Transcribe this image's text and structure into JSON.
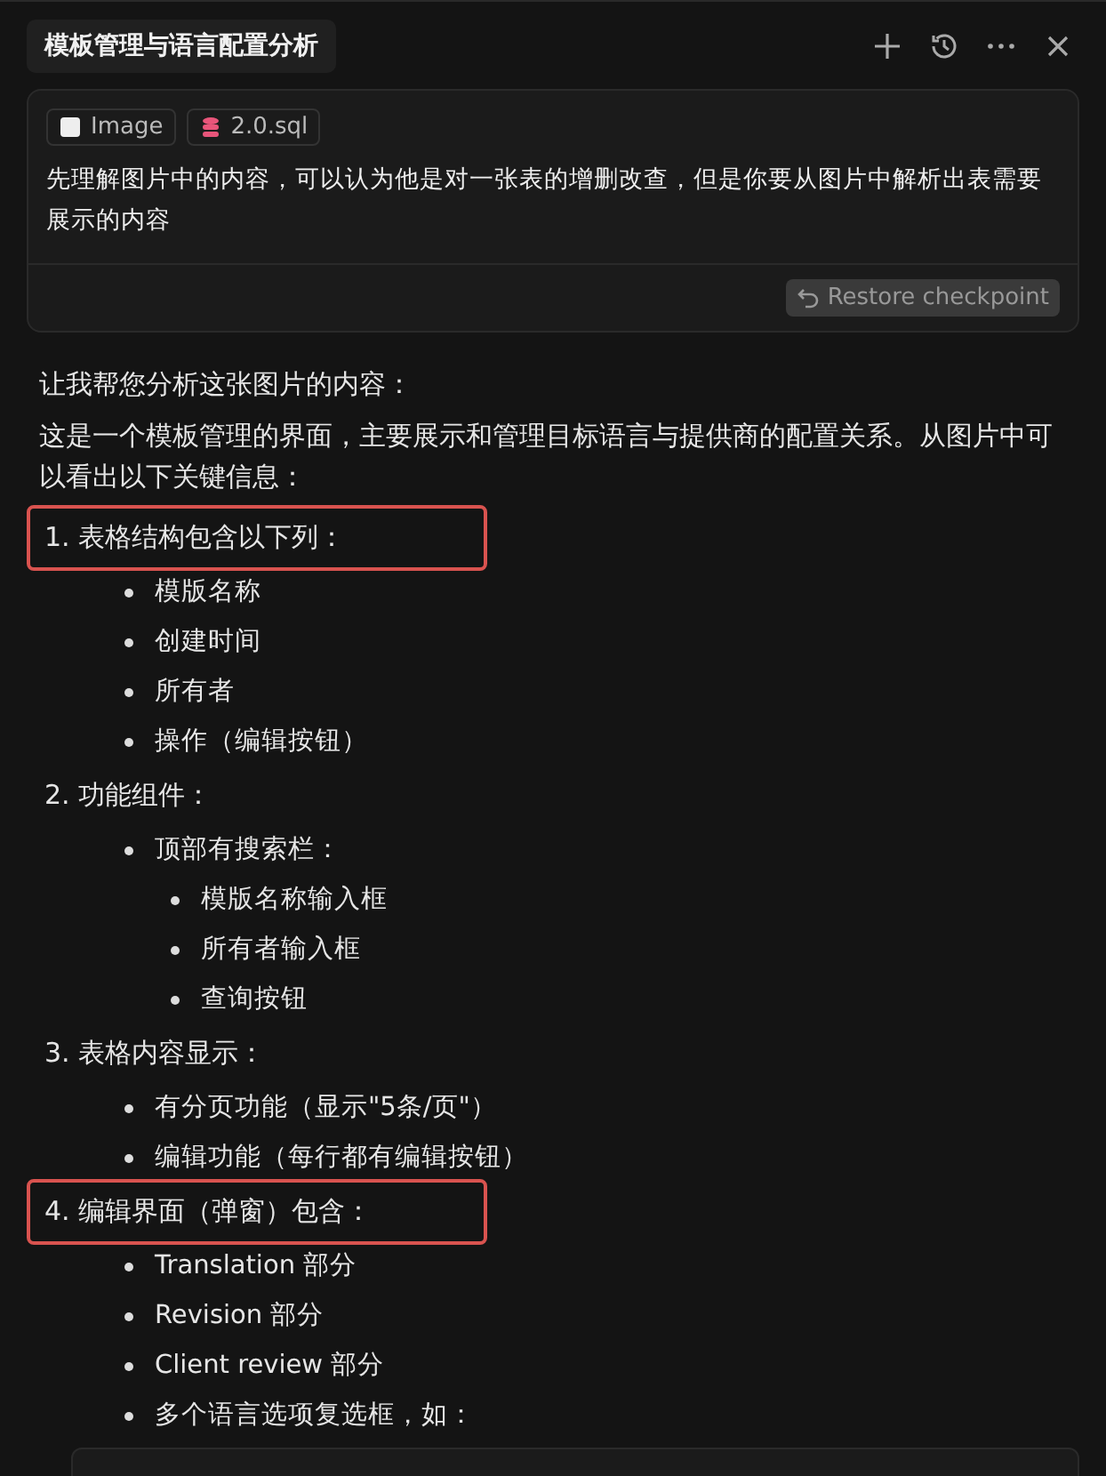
{
  "tab": {
    "title": "模板管理与语言配置分析"
  },
  "message": {
    "attachments": [
      {
        "kind": "image",
        "label": "Image"
      },
      {
        "kind": "database",
        "label": "2.0.sql"
      }
    ],
    "text": "先理解图片中的内容，可以认为他是对一张表的增删改查，但是你要从图片中解析出表需要展示的内容",
    "restore_button": "Restore checkpoint"
  },
  "reply": {
    "paragraphs": [
      "让我帮您分析这张图片的内容：",
      "这是一个模板管理的界面，主要展示和管理目标语言与提供商的配置关系。从图片中可以看出以下关键信息："
    ],
    "sections": [
      {
        "title": "1. 表格结构包含以下列：",
        "highlighted": true,
        "items": [
          {
            "text": "模版名称"
          },
          {
            "text": "创建时间"
          },
          {
            "text": "所有者"
          },
          {
            "text": "操作（编辑按钮）"
          }
        ]
      },
      {
        "title": "2. 功能组件：",
        "highlighted": false,
        "items": [
          {
            "text": "顶部有搜索栏：",
            "children": [
              {
                "text": "模版名称输入框"
              },
              {
                "text": "所有者输入框"
              },
              {
                "text": "查询按钮"
              }
            ]
          }
        ]
      },
      {
        "title": "3. 表格内容显示：",
        "highlighted": false,
        "items": [
          {
            "text": "有分页功能（显示\"5条/页\"）"
          },
          {
            "text": "编辑功能（每行都有编辑按钮）"
          }
        ]
      },
      {
        "title": "4. 编辑界面（弹窗）包含：",
        "highlighted": true,
        "items": [
          {
            "text": "Translation 部分"
          },
          {
            "text": "Revision 部分"
          },
          {
            "text": "Client review 部分"
          },
          {
            "text": "多个语言选项复选框，如："
          }
        ]
      }
    ]
  }
}
